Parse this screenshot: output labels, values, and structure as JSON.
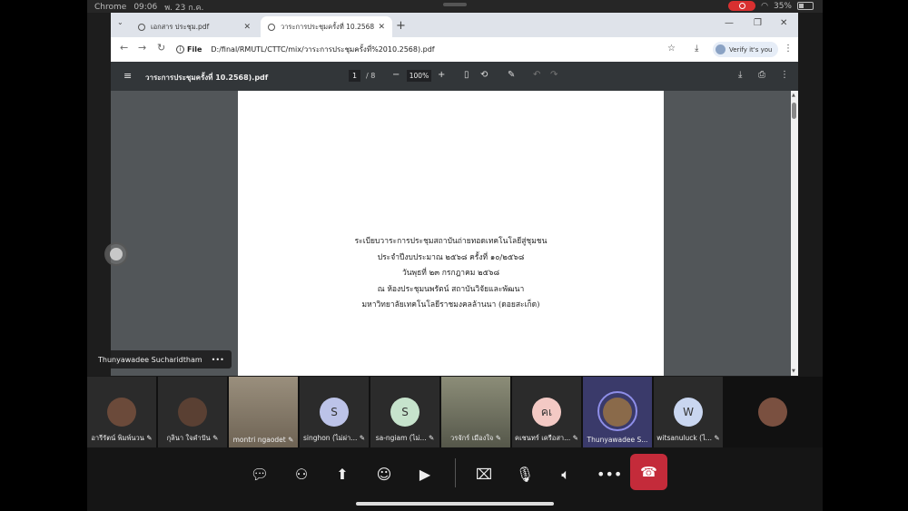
{
  "status": {
    "carrier": "Chrome",
    "time": "09:06",
    "date": "พ. 23 ก.ค.",
    "battery": "35%"
  },
  "browser": {
    "tabs": [
      {
        "label": "เอกสาร ประชุม.pdf"
      },
      {
        "label": "วาระการประชุมครั้งที่ 10.2568).pdf"
      }
    ],
    "address": {
      "scheme": "File",
      "path": "D:/final/RMUTL/CTTC/mix/วาระการประชุมครั้งที่%2010.2568).pdf"
    },
    "verify_label": "Verify it's you"
  },
  "pdf": {
    "title": "วาระการประชุมครั้งที่ 10.2568).pdf",
    "page": "1",
    "total": "/ 8",
    "zoom": "100%",
    "lines": [
      "ระเบียบวาระการประชุมสถาบันถ่ายทอดเทคโนโลยีสู่ชุมชน",
      "ประจำปีงบประมาณ ๒๕๖๘ ครั้งที่ ๑๐/๒๕๖๘",
      "วันพุธที่ ๒๓ กรกฎาคม ๒๕๖๘",
      "ณ ห้องประชุมนพรัตน์ สถาบันวิจัยและพัฒนา",
      "มหาวิทยาลัยเทคโนโลยีราชมงคลล้านนา (ดอยสะเก็ด)"
    ]
  },
  "speaker": {
    "name": "Thunyawadee Sucharidtham"
  },
  "participants": [
    {
      "name": "อารีรัตน์ พิมพ์นวน",
      "initials": "",
      "color": "#6b4a3a"
    },
    {
      "name": "กุลินา  ใจคำปัน",
      "initials": "",
      "color": "#5a4033"
    },
    {
      "name": "montri ngaodet",
      "initials": "",
      "color": "#7d6e5c"
    },
    {
      "name": "singhon (ไม่ผ่า...",
      "initials": "S",
      "color": "#bcc3e8"
    },
    {
      "name": "sa-ngiam (ไม่...",
      "initials": "S",
      "color": "#c6e3cc"
    },
    {
      "name": "วรจักร์  เมืองใจ",
      "initials": "",
      "color": "#6f7060"
    },
    {
      "name": "คเชนทร์ เครือสา...",
      "initials": "คเ",
      "color": "#f3c9c4"
    },
    {
      "name": "Thunyawadee S...",
      "initials": "",
      "color": "#8a6a4a"
    },
    {
      "name": "witsanuluck (ไ...",
      "initials": "W",
      "color": "#c9d6f0"
    },
    {
      "name": "",
      "initials": "",
      "color": "#7a5040"
    }
  ]
}
